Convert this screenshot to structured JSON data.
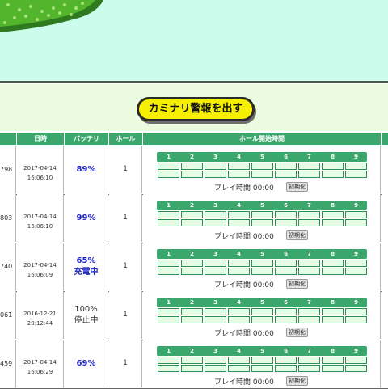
{
  "alert_button": "カミナリ警報を出す",
  "headers": {
    "date": "日時",
    "battery": "バッテリ",
    "hole": "ホール",
    "hole_start": "ホール開始時間"
  },
  "hole_numbers": [
    "1",
    "2",
    "3",
    "4",
    "5",
    "6",
    "7",
    "8",
    "9"
  ],
  "play_time_label": "プレイ時間 00:00",
  "init_button": "初期化",
  "rows": [
    {
      "id": "798",
      "date": "2017-04-14",
      "time": "16:06:10",
      "battery": "89%",
      "status": "",
      "hole": "1"
    },
    {
      "id": "803",
      "date": "2017-04-14",
      "time": "16:06:10",
      "battery": "99%",
      "status": "",
      "hole": "1"
    },
    {
      "id": "740",
      "date": "2017-04-14",
      "time": "16:06:09",
      "battery": "65%",
      "status": "充電中",
      "hole": "1"
    },
    {
      "id": "061",
      "date": "2016-12-21",
      "time": "20:12:44",
      "battery": "100%",
      "status": "停止中",
      "hole": "1"
    },
    {
      "id": "459",
      "date": "2017-04-14",
      "time": "16:06:29",
      "battery": "69%",
      "status": "",
      "hole": "1"
    }
  ],
  "colors": {
    "header_green": "#3ca76d",
    "battery_blue": "#1d26c6",
    "button_yellow": "#f6f000",
    "map_bg": "#ccfcec"
  }
}
